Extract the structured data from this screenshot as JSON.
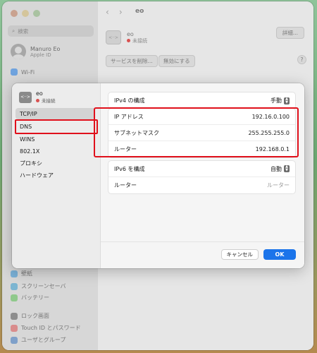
{
  "background": {
    "search_placeholder": "検索",
    "user_name": "Manuro Eo",
    "user_sub": "Apple ID",
    "sidebar_items": [
      {
        "label": "Wi-Fi",
        "color": "#6fa3de"
      },
      {
        "label": "壁紙",
        "color": "#7ab0d6"
      },
      {
        "label": "スクリーンセーバ",
        "color": "#7cb5d1"
      },
      {
        "label": "バッテリー",
        "color": "#8fc98b"
      },
      {
        "label": "ロック画面",
        "color": "#8d8d8d"
      },
      {
        "label": "Touch ID とパスワード",
        "color": "#d98c8c"
      },
      {
        "label": "ユーザとグループ",
        "color": "#7fa0c9"
      }
    ],
    "page_title": "eo",
    "service_name": "eo",
    "service_status": "未接続",
    "details_label": "詳細...",
    "remove_service_label": "サービスを削除...",
    "disable_label": "無効にする",
    "help_label": "?"
  },
  "dialog": {
    "service_name": "eo",
    "service_status": "未接続",
    "service_icon": "<··>",
    "nav_items": [
      "TCP/IP",
      "DNS",
      "WINS",
      "802.1X",
      "プロキシ",
      "ハードウェア"
    ],
    "ipv4": {
      "config_label": "IPv4 の構成",
      "config_value": "手動",
      "ip_label": "IP アドレス",
      "ip_value": "192.16.0.100",
      "subnet_label": "サブネットマスク",
      "subnet_value": "255.255.255.0",
      "router_label": "ルーター",
      "router_value": "192.168.0.1"
    },
    "ipv6": {
      "config_label": "IPv6 を構成",
      "config_value": "自動",
      "router_label": "ルーター",
      "router_placeholder": "ルーター"
    },
    "cancel_label": "キャンセル",
    "ok_label": "OK"
  },
  "colors": {
    "accent": "#1b74ea",
    "highlight": "#e0101b",
    "status_red": "#d9504f"
  }
}
